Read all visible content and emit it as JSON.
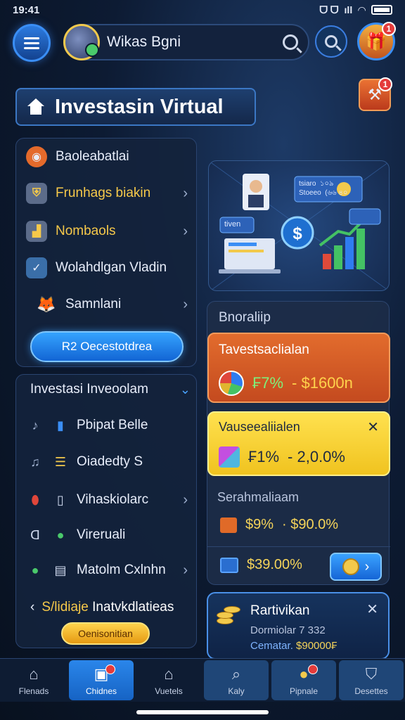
{
  "status": {
    "time": "19:41",
    "carrier": "ᗜ ᗜ",
    "signal": "ıll"
  },
  "topbar": {
    "search_text": "Wikas Bgni"
  },
  "header": {
    "title": "Investasin Virtual",
    "gift_badge": "1",
    "tool_badge": "1"
  },
  "menu1": {
    "items": [
      {
        "label": "Baoleabatlai",
        "color": "#ffffff"
      },
      {
        "label": "Frunhags biakin",
        "color": "#f6c94a"
      },
      {
        "label": "Nombaols",
        "color": "#f6c94a"
      },
      {
        "label": "Wolahdlgan Vladin",
        "color": "#ffffff"
      },
      {
        "label": "Samnlani",
        "color": "#ffffff"
      }
    ],
    "button": "R2 Oecestotdrea"
  },
  "menu2": {
    "title": "Investasi Inveoolam",
    "items": [
      {
        "label": "Pbipat Belle"
      },
      {
        "label": "Oiadedty S"
      },
      {
        "label": "Vihaskiolarc"
      },
      {
        "label": "Vireruali"
      },
      {
        "label": "Matolm Cxlnhn"
      }
    ],
    "back_prefix": "S/lidiaje",
    "back_label": "Inatvkdlatieas",
    "gold_button": "Oenisonitian"
  },
  "illustration": {
    "tag1": "tsiaro  ১০৯\nStoeeo  (৬৬ ৪০",
    "tag2": "tiven"
  },
  "cards": {
    "section_title": "Bnoraliip",
    "orange": {
      "title": "Tavestsaclialan",
      "pct": "₣7%",
      "amount": "- $1600n"
    },
    "yellow": {
      "title": "Vauseealiialen",
      "pct": "₣1%",
      "amount": "- 2,0.0%"
    },
    "dark1": {
      "title": "Serahmaliaam",
      "pct": "$9%",
      "amount": "· $90.0%"
    },
    "dark2": {
      "amount": "$39.00%"
    }
  },
  "notif": {
    "title": "Rartivikan",
    "line1": "Dormiolar 7 332",
    "line2_prefix": "Cematar.",
    "line2_value": "$90000₣"
  },
  "tabs": [
    {
      "label": "Flenads",
      "icon": "home-icon"
    },
    {
      "label": "Chidnes",
      "icon": "wallet-icon"
    },
    {
      "label": "Vuetels",
      "icon": "store-icon"
    },
    {
      "label": "Kaly",
      "icon": "search-icon"
    },
    {
      "label": "Pipnale",
      "icon": "coin-icon"
    },
    {
      "label": "Desettes",
      "icon": "profile-icon"
    }
  ]
}
